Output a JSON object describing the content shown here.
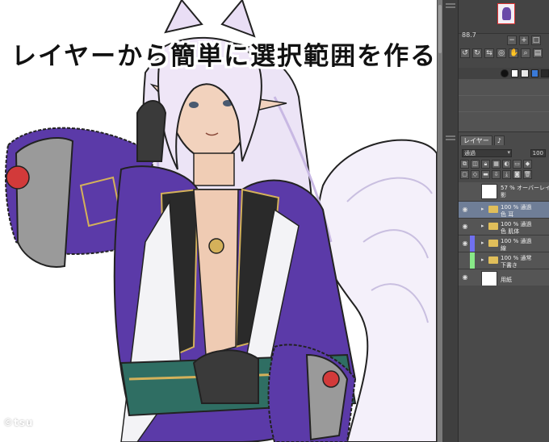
{
  "title_banner": "レイヤーから簡単に選択範囲を作る方法",
  "watermark": "©tsu",
  "navigator": {
    "zoom_value": "88.7"
  },
  "layer_panel": {
    "tabs": [
      "レイヤー",
      "♪"
    ],
    "blend_mode": "通過",
    "opacity": "100",
    "layers": [
      {
        "line1": "57 % オーバーレイ",
        "line2": "影",
        "type": "raster",
        "selected": false,
        "color": ""
      },
      {
        "line1": "100 % 通過",
        "line2": "色 耳",
        "type": "folder",
        "selected": true,
        "color": ""
      },
      {
        "line1": "100 % 通過",
        "line2": "色 肌体",
        "type": "folder",
        "selected": false,
        "color": ""
      },
      {
        "line1": "100 % 通過",
        "line2": "線",
        "type": "folder",
        "selected": false,
        "color": "#7070f0"
      },
      {
        "line1": "100 % 通常",
        "line2": "下書き",
        "type": "folder",
        "selected": false,
        "color": "#88e888"
      },
      {
        "line1": "",
        "line2": "用紙",
        "type": "paper",
        "selected": false,
        "color": ""
      }
    ]
  },
  "colors": {
    "panel_bg": "#4d4d4d",
    "selected_layer": "#6f7e97",
    "robe_purple": "#5b3aa8",
    "hair": "#efe6f7"
  }
}
